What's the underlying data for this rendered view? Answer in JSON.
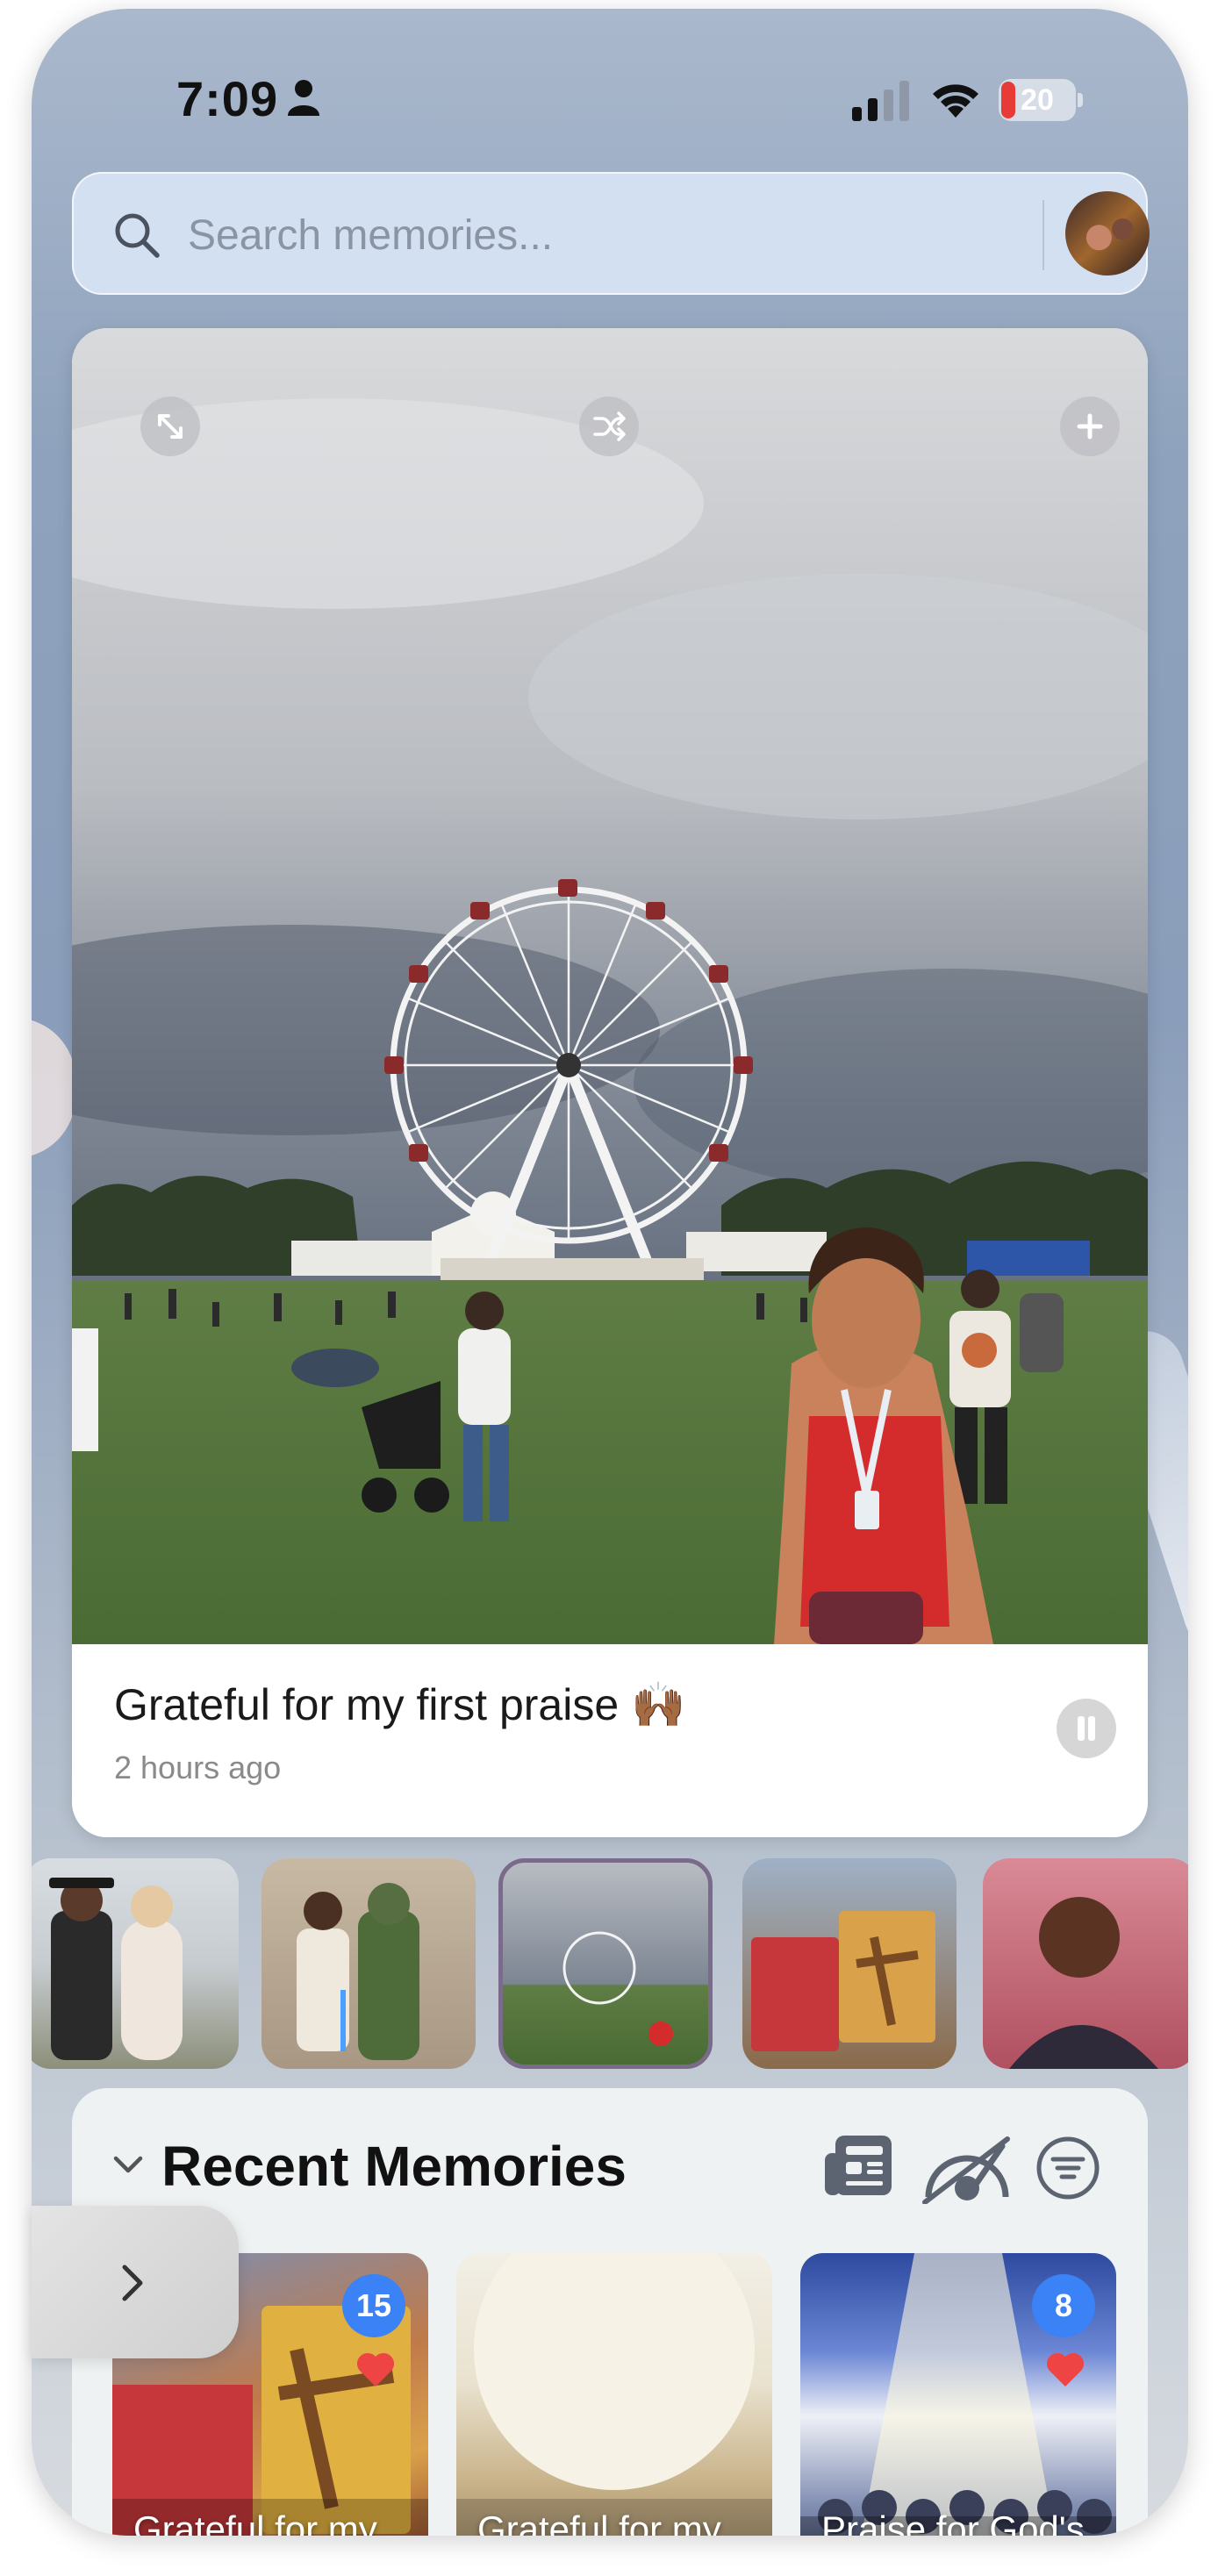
{
  "status_bar": {
    "time": "7:09",
    "battery": "20",
    "battery_level": 0.2,
    "battery_color": "#e63b36"
  },
  "search": {
    "placeholder": "Search memories..."
  },
  "featured": {
    "title": "Grateful for my first praise 🙌🏾",
    "time_ago": "2 hours ago",
    "controls": [
      "expand-icon",
      "shuffle-icon",
      "plus-icon"
    ]
  },
  "recent": {
    "heading": "Recent Memories",
    "items": [
      {
        "title": "Grateful for my first prai...",
        "badge": "15",
        "favorited": true
      },
      {
        "title": "Grateful for my First Prai...",
        "badge": "",
        "favorited": false
      },
      {
        "title": "Praise for God's Abun...",
        "badge": "8",
        "favorited": true
      }
    ]
  },
  "colors": {
    "badge": "#3b82f6",
    "heart": "#ef4444",
    "selected_thumb_border": "#7a6b8a"
  }
}
